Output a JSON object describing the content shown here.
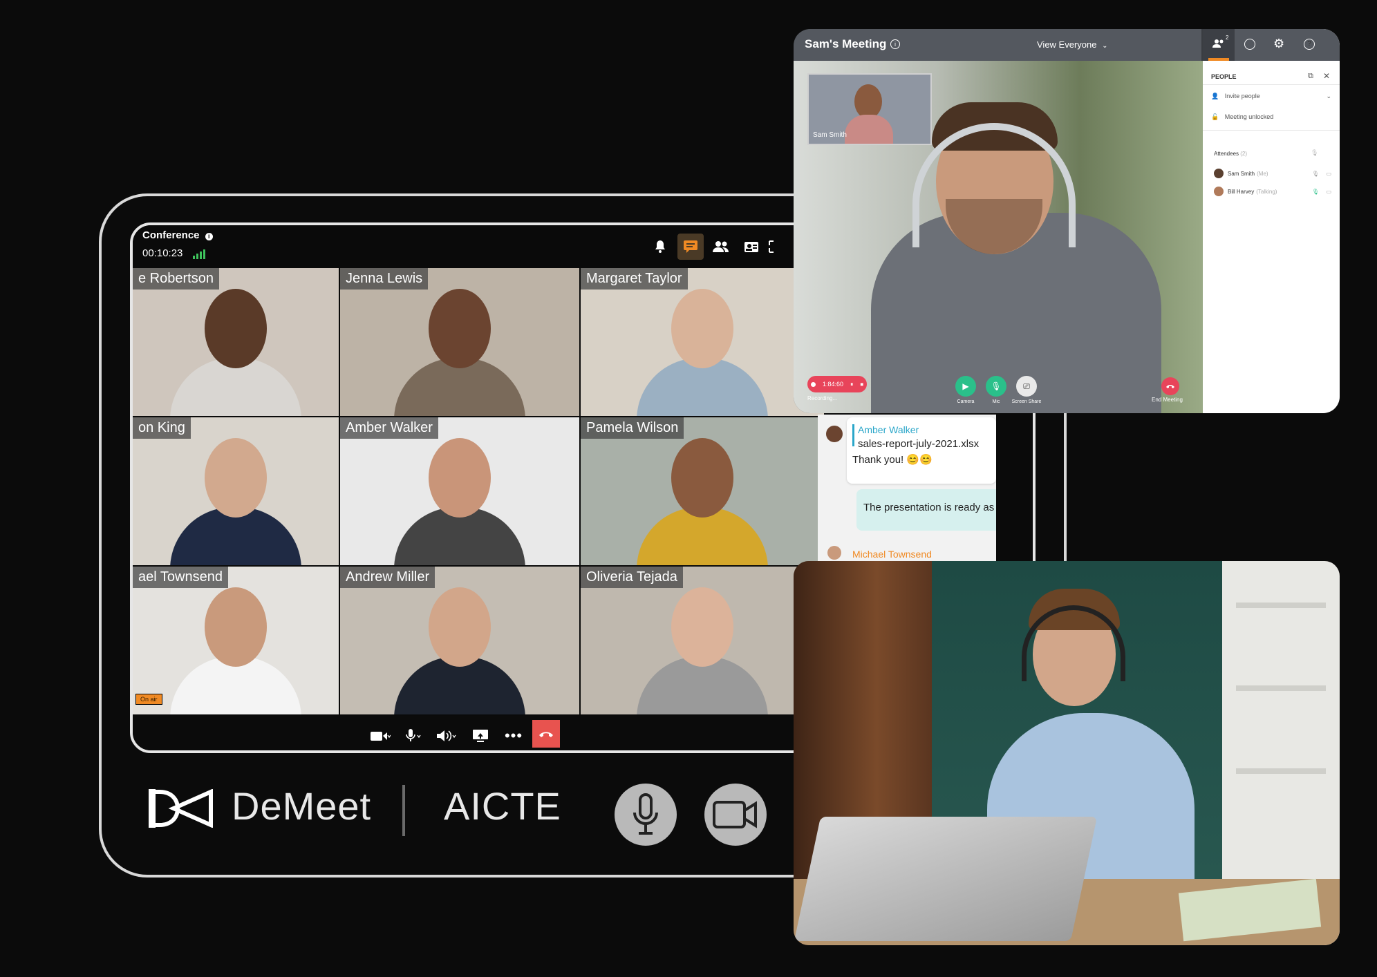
{
  "conference": {
    "title": "Conference",
    "info_icon": "info-icon",
    "timer": "00:10:23",
    "toolbar_icons": [
      "bell-icon",
      "chat-icon",
      "people-icon",
      "contacts-icon",
      "fullscreen-icon"
    ],
    "accent": "#f08a24",
    "participants": [
      {
        "name": "e Robertson",
        "bg": "#cfc6bd",
        "skin": "#5a3a28",
        "shirt": "#d9d6d2"
      },
      {
        "name": "Jenna Lewis",
        "bg": "#bdb3a6",
        "skin": "#6b4430",
        "shirt": "#7a6a5a"
      },
      {
        "name": "Margaret Taylor",
        "bg": "#d8d1c6",
        "skin": "#d9b399",
        "shirt": "#9bb0c2"
      },
      {
        "name": "on King",
        "bg": "#d9d4cc",
        "skin": "#d2a98e",
        "shirt": "#1f2a44"
      },
      {
        "name": "Amber Walker",
        "bg": "#e9e9e9",
        "skin": "#c99579",
        "shirt": "#444444"
      },
      {
        "name": "Pamela Wilson",
        "bg": "#a9b0a8",
        "skin": "#8a5a3e",
        "shirt": "#d4a72c"
      },
      {
        "name": "ael Townsend",
        "bg": "#e4e2de",
        "skin": "#c99a7c",
        "shirt": "#f4f4f4"
      },
      {
        "name": "Andrew Miller",
        "bg": "#c4bdb3",
        "skin": "#d2a68a",
        "shirt": "#1e2430"
      },
      {
        "name": "Oliveria Tejada",
        "bg": "#bfb8ae",
        "skin": "#dcb39a",
        "shirt": "#9a9a9a"
      }
    ],
    "on_air_badge": "On air",
    "bottom_controls": [
      "video-icon",
      "mic-icon",
      "speaker-icon",
      "share-screen-icon",
      "more-icon",
      "hangup-icon"
    ],
    "hangup_color": "#e8534f"
  },
  "brand": {
    "name": "DeMeet",
    "partner": "AICTE",
    "mic_icon": "mic-icon",
    "camera_icon": "camera-icon"
  },
  "chat": {
    "messages": [
      {
        "author": "Amber Walker",
        "lines": [
          "sales-report-july-2021.xlsx",
          "Thank you! 😊😊"
        ]
      },
      {
        "text": "The presentation is ready as"
      },
      {
        "author": "Michael Townsend"
      }
    ],
    "author_color": "#2aa6c9",
    "author2_color": "#f08a24"
  },
  "meeting": {
    "title": "Sam's Meeting",
    "view_label": "View Everyone",
    "header_icons": [
      "people-icon",
      "chat-icon",
      "gear-icon",
      "help-icon"
    ],
    "people_badge": "2",
    "self_label": "Sam Smith",
    "recording_time": "1:84:60",
    "recording_label": "Recording...",
    "controls": [
      {
        "icon": "camera-icon",
        "label": "Camera",
        "color": "#2ac08a"
      },
      {
        "icon": "mic-icon",
        "label": "Mic",
        "color": "#2ac08a"
      },
      {
        "icon": "screen-share-icon",
        "label": "Screen Share",
        "color": "#e9e9e9"
      }
    ],
    "end_label": "End Meeting",
    "end_color": "#e8445a",
    "people_panel": {
      "title": "PEOPLE",
      "invite": "Invite people",
      "lock": "Meeting unlocked",
      "attendees_label": "Attendees",
      "attendees_count": "(2)",
      "attendees": [
        {
          "name": "Sam Smith",
          "tag": "(Me)"
        },
        {
          "name": "Bill Harvey",
          "tag": "(Talking)"
        }
      ]
    }
  }
}
